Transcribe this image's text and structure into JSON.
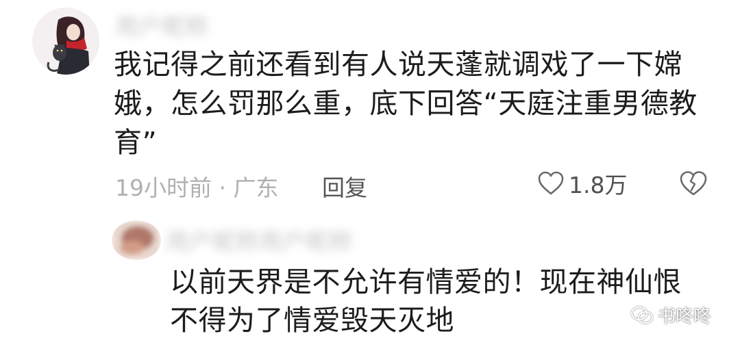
{
  "comments": [
    {
      "username": "用户昵称",
      "text_lines": [
        "我记得之前还看到有人说天蓬就调戏了一下嫦",
        "娥，怎么罚那么重，底下回答“天庭注重男德教",
        "育”"
      ],
      "time_location": "19小时前 · 广东",
      "reply_label": "回复",
      "like_count": "1.8万",
      "avatar_icon": "anime-girl-with-cat-avatar",
      "like_icon": "heart-outline-icon",
      "dislike_icon": "broken-heart-icon"
    },
    {
      "username": "用户昵称用户昵称",
      "text_lines": [
        "以前天界是不允许有情爱的！现在神仙恨",
        "不得为了情爱毁天灭地"
      ],
      "avatar_icon": "avatar-blurred"
    }
  ],
  "watermark": {
    "text": "书咚咚",
    "icon": "wechat-official-account-icon"
  },
  "colors": {
    "text_primary": "#1c1c1c",
    "text_meta": "#b0b0b0",
    "icon_gray": "#6a6a6a"
  }
}
